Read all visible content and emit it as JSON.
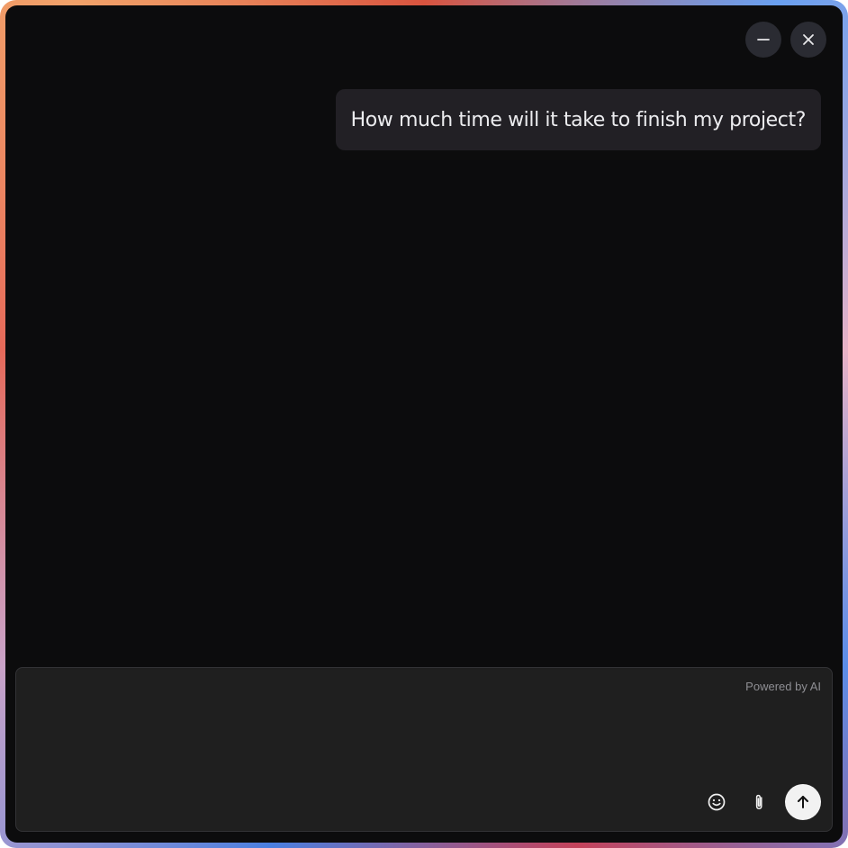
{
  "header": {
    "minimize_icon": "minimize-icon",
    "close_icon": "close-icon"
  },
  "messages": [
    {
      "role": "user",
      "text": "How much time will it take to finish my project?"
    }
  ],
  "composer": {
    "value": "",
    "powered_by": "Powered by AI",
    "emoji_icon": "smiley-face-icon",
    "attach_icon": "paperclip-icon",
    "send_icon": "arrow-up-icon"
  },
  "colors": {
    "window_bg": "#0c0c0d",
    "bubble_bg": "#222025",
    "composer_bg": "#1f1f1f",
    "send_button_bg": "#f2f2f2",
    "control_button_bg": "#2a2b32"
  }
}
